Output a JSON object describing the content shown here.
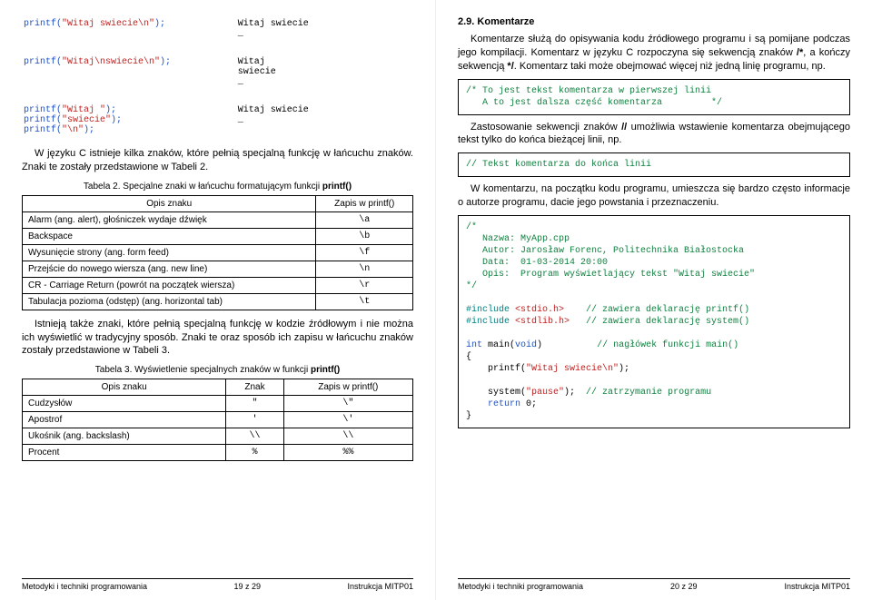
{
  "left": {
    "examples": [
      {
        "code": "printf(\"Witaj swiecie\\n\");",
        "out": "Witaj swiecie\n_"
      },
      {
        "code": "printf(\"Witaj\\nswiecie\\n\");",
        "out": "Witaj\nswiecie\n_"
      },
      {
        "code": "printf(\"Witaj \");\nprintf(\"swiecie\");\nprintf(\"\\n\");",
        "out": "Witaj swiecie\n_"
      }
    ],
    "para1": "W języku C istnieje kilka znaków, które pełnią specjalną funkcję w łańcuchu znaków. Znaki te zostały przedstawione w Tabeli 2.",
    "caption2": "Tabela 2. Specjalne znaki w łańcuchu formatującym funkcji printf()",
    "t2head": [
      "Opis znaku",
      "Zapis w printf()"
    ],
    "t2rows": [
      {
        "d": "Alarm (ang. alert), głośniczek wydaje dźwięk",
        "z": "\\a"
      },
      {
        "d": "Backspace",
        "z": "\\b"
      },
      {
        "d": "Wysunięcie strony (ang. form feed)",
        "z": "\\f"
      },
      {
        "d": "Przejście do nowego wiersza (ang. new line)",
        "z": "\\n"
      },
      {
        "d": "CR - Carriage Return (powrót na początek wiersza)",
        "z": "\\r"
      },
      {
        "d": "Tabulacja pozioma (odstęp) (ang. horizontal tab)",
        "z": "\\t"
      }
    ],
    "para2": "Istnieją także znaki, które pełnią specjalną funkcję w kodzie źródłowym i nie można ich wyświetlić w tradycyjny sposób. Znaki te oraz sposób ich zapisu w łańcuchu znaków zostały przedstawione w Tabeli 3.",
    "caption3": "Tabela 3. Wyświetlenie specjalnych znaków w funkcji printf()",
    "t3head": [
      "Opis znaku",
      "Znak",
      "Zapis w printf()"
    ],
    "t3rows": [
      {
        "d": "Cudzysłów",
        "z": "\"",
        "p": "\\\""
      },
      {
        "d": "Apostrof",
        "z": "'",
        "p": "\\'"
      },
      {
        "d": "Ukośnik (ang. backslash)",
        "z": "\\\\",
        "p": "\\\\"
      },
      {
        "d": "Procent",
        "z": "%",
        "p": "%%"
      }
    ],
    "footer": {
      "l": "Metodyki i techniki programowania",
      "c": "19 z 29",
      "r": "Instrukcja MITP01"
    }
  },
  "right": {
    "heading": "2.9. Komentarze",
    "para1": "Komentarze służą do opisywania kodu źródłowego programu i są pomijane podczas jego kompilacji. Komentarz w języku C rozpoczyna się sekwencją znaków /*, a kończy sekwencją */. Komentarz taki może obejmować więcej niż jedną linię programu, np.",
    "code1": "/* To jest tekst komentarza w pierwszej linii\n   A to jest dalsza część komentarza         */",
    "para2": "Zastosowanie sekwencji znaków // umożliwia wstawienie komentarza obejmującego tekst tylko do końca bieżącej linii, np.",
    "code2": "// Tekst komentarza do końca linii",
    "para3": "W komentarzu, na początku kodu programu, umieszcza się bardzo często informacje o autorze programu, dacie jego powstania i przeznaczeniu.",
    "code3": {
      "c1": "/*",
      "c2": "   Nazwa: MyApp.cpp",
      "c3": "   Autor: Jarosław Forenc, Politechnika Białostocka",
      "c4": "   Data:  01-03-2014 20:00",
      "c5": "   Opis:  Program wyświetlający tekst \"Witaj swiecie\"",
      "c6": "*/",
      "inc1a": "#include ",
      "inc1b": "<stdio.h>",
      "inc1c": "    // zawiera deklarację printf()",
      "inc2a": "#include ",
      "inc2b": "<stdlib.h>",
      "inc2c": "   // zawiera deklarację system()",
      "main1a": "int",
      "main1b": " main(",
      "main1c": "void",
      "main1d": ")          ",
      "main1e": "// nagłówek funkcji main()",
      "brace1": "{",
      "pr1": "    printf(",
      "pr1s": "\"Witaj swiecie\\n\"",
      "pr1e": ");",
      "sys1": "    system(",
      "sys1s": "\"pause\"",
      "sys1e": ");  ",
      "sys1c": "// zatrzymanie programu",
      "ret1": "    return",
      "ret1b": " 0;",
      "brace2": "}"
    },
    "footer": {
      "l": "Metodyki i techniki programowania",
      "c": "20 z 29",
      "r": "Instrukcja MITP01"
    }
  }
}
